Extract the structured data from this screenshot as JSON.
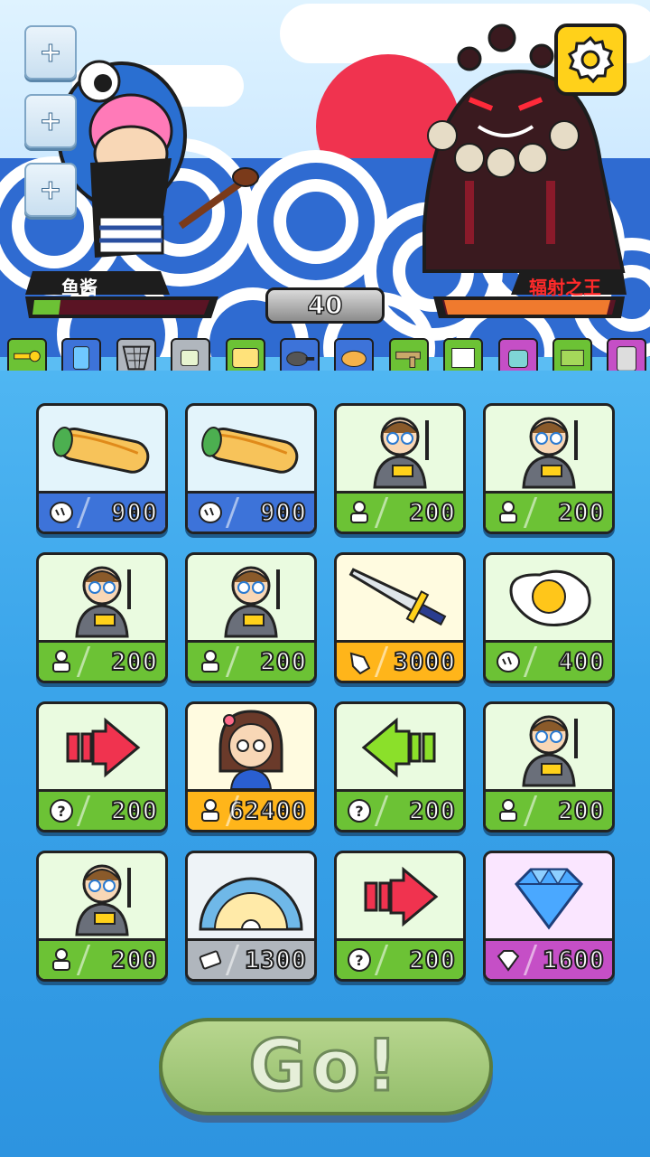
{
  "player": {
    "name": "鱼酱",
    "hp_fraction": 0.15
  },
  "enemy": {
    "name": "辐射之王",
    "hp_fraction": 0.95
  },
  "level": "40",
  "colors": {
    "green_bar": "#6cc235",
    "blue_bar": "#3d73d9",
    "orange_bar": "#ffb51a",
    "purple_bar": "#c54fc6",
    "gray_bar": "#b0b6bd"
  },
  "item_icons": [
    "key-icon",
    "can-icon",
    "net-icon",
    "pipe-icon",
    "id-card-icon",
    "frying-pan-icon",
    "bread-nest-icon",
    "gun-icon",
    "paper-icon",
    "robot-icon",
    "cash-stack-icon",
    "calculator-icon"
  ],
  "cards": [
    {
      "art": "burrito",
      "currency": "bread",
      "price": "900",
      "theme": "blue"
    },
    {
      "art": "burrito",
      "currency": "bread",
      "price": "900",
      "theme": "blue"
    },
    {
      "art": "teacher",
      "currency": "person",
      "price": "200",
      "theme": "green"
    },
    {
      "art": "teacher",
      "currency": "person",
      "price": "200",
      "theme": "green"
    },
    {
      "art": "teacher",
      "currency": "person",
      "price": "200",
      "theme": "green"
    },
    {
      "art": "teacher",
      "currency": "person",
      "price": "200",
      "theme": "green"
    },
    {
      "art": "sword",
      "currency": "glove",
      "price": "3000",
      "theme": "orange"
    },
    {
      "art": "egg",
      "currency": "bread",
      "price": "400",
      "theme": "green"
    },
    {
      "art": "arrow-right",
      "currency": "question",
      "price": "200",
      "theme": "green"
    },
    {
      "art": "girl",
      "currency": "person",
      "price": "62400",
      "theme": "orange"
    },
    {
      "art": "arrow-left",
      "currency": "question",
      "price": "200",
      "theme": "green"
    },
    {
      "art": "teacher",
      "currency": "person",
      "price": "200",
      "theme": "green"
    },
    {
      "art": "teacher",
      "currency": "person",
      "price": "200",
      "theme": "green"
    },
    {
      "art": "protractor",
      "currency": "eraser",
      "price": "1300",
      "theme": "gray"
    },
    {
      "art": "arrow-right",
      "currency": "question",
      "price": "200",
      "theme": "green"
    },
    {
      "art": "diamond",
      "currency": "diamond",
      "price": "1600",
      "theme": "purple"
    }
  ],
  "go_label": "Go!"
}
